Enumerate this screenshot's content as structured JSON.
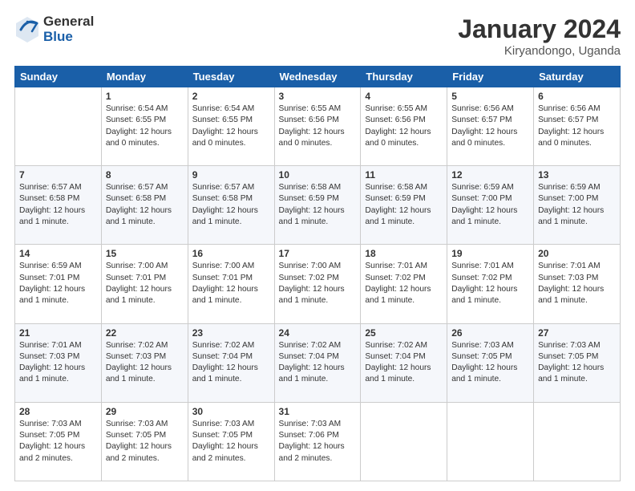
{
  "header": {
    "logo_general": "General",
    "logo_blue": "Blue",
    "month_title": "January 2024",
    "location": "Kiryandongo, Uganda"
  },
  "weekdays": [
    "Sunday",
    "Monday",
    "Tuesday",
    "Wednesday",
    "Thursday",
    "Friday",
    "Saturday"
  ],
  "weeks": [
    [
      {
        "day": "",
        "sunrise": "",
        "sunset": "",
        "daylight": ""
      },
      {
        "day": "1",
        "sunrise": "Sunrise: 6:54 AM",
        "sunset": "Sunset: 6:55 PM",
        "daylight": "Daylight: 12 hours and 0 minutes."
      },
      {
        "day": "2",
        "sunrise": "Sunrise: 6:54 AM",
        "sunset": "Sunset: 6:55 PM",
        "daylight": "Daylight: 12 hours and 0 minutes."
      },
      {
        "day": "3",
        "sunrise": "Sunrise: 6:55 AM",
        "sunset": "Sunset: 6:56 PM",
        "daylight": "Daylight: 12 hours and 0 minutes."
      },
      {
        "day": "4",
        "sunrise": "Sunrise: 6:55 AM",
        "sunset": "Sunset: 6:56 PM",
        "daylight": "Daylight: 12 hours and 0 minutes."
      },
      {
        "day": "5",
        "sunrise": "Sunrise: 6:56 AM",
        "sunset": "Sunset: 6:57 PM",
        "daylight": "Daylight: 12 hours and 0 minutes."
      },
      {
        "day": "6",
        "sunrise": "Sunrise: 6:56 AM",
        "sunset": "Sunset: 6:57 PM",
        "daylight": "Daylight: 12 hours and 0 minutes."
      }
    ],
    [
      {
        "day": "7",
        "sunrise": "Sunrise: 6:57 AM",
        "sunset": "Sunset: 6:58 PM",
        "daylight": "Daylight: 12 hours and 1 minute."
      },
      {
        "day": "8",
        "sunrise": "Sunrise: 6:57 AM",
        "sunset": "Sunset: 6:58 PM",
        "daylight": "Daylight: 12 hours and 1 minute."
      },
      {
        "day": "9",
        "sunrise": "Sunrise: 6:57 AM",
        "sunset": "Sunset: 6:58 PM",
        "daylight": "Daylight: 12 hours and 1 minute."
      },
      {
        "day": "10",
        "sunrise": "Sunrise: 6:58 AM",
        "sunset": "Sunset: 6:59 PM",
        "daylight": "Daylight: 12 hours and 1 minute."
      },
      {
        "day": "11",
        "sunrise": "Sunrise: 6:58 AM",
        "sunset": "Sunset: 6:59 PM",
        "daylight": "Daylight: 12 hours and 1 minute."
      },
      {
        "day": "12",
        "sunrise": "Sunrise: 6:59 AM",
        "sunset": "Sunset: 7:00 PM",
        "daylight": "Daylight: 12 hours and 1 minute."
      },
      {
        "day": "13",
        "sunrise": "Sunrise: 6:59 AM",
        "sunset": "Sunset: 7:00 PM",
        "daylight": "Daylight: 12 hours and 1 minute."
      }
    ],
    [
      {
        "day": "14",
        "sunrise": "Sunrise: 6:59 AM",
        "sunset": "Sunset: 7:01 PM",
        "daylight": "Daylight: 12 hours and 1 minute."
      },
      {
        "day": "15",
        "sunrise": "Sunrise: 7:00 AM",
        "sunset": "Sunset: 7:01 PM",
        "daylight": "Daylight: 12 hours and 1 minute."
      },
      {
        "day": "16",
        "sunrise": "Sunrise: 7:00 AM",
        "sunset": "Sunset: 7:01 PM",
        "daylight": "Daylight: 12 hours and 1 minute."
      },
      {
        "day": "17",
        "sunrise": "Sunrise: 7:00 AM",
        "sunset": "Sunset: 7:02 PM",
        "daylight": "Daylight: 12 hours and 1 minute."
      },
      {
        "day": "18",
        "sunrise": "Sunrise: 7:01 AM",
        "sunset": "Sunset: 7:02 PM",
        "daylight": "Daylight: 12 hours and 1 minute."
      },
      {
        "day": "19",
        "sunrise": "Sunrise: 7:01 AM",
        "sunset": "Sunset: 7:02 PM",
        "daylight": "Daylight: 12 hours and 1 minute."
      },
      {
        "day": "20",
        "sunrise": "Sunrise: 7:01 AM",
        "sunset": "Sunset: 7:03 PM",
        "daylight": "Daylight: 12 hours and 1 minute."
      }
    ],
    [
      {
        "day": "21",
        "sunrise": "Sunrise: 7:01 AM",
        "sunset": "Sunset: 7:03 PM",
        "daylight": "Daylight: 12 hours and 1 minute."
      },
      {
        "day": "22",
        "sunrise": "Sunrise: 7:02 AM",
        "sunset": "Sunset: 7:03 PM",
        "daylight": "Daylight: 12 hours and 1 minute."
      },
      {
        "day": "23",
        "sunrise": "Sunrise: 7:02 AM",
        "sunset": "Sunset: 7:04 PM",
        "daylight": "Daylight: 12 hours and 1 minute."
      },
      {
        "day": "24",
        "sunrise": "Sunrise: 7:02 AM",
        "sunset": "Sunset: 7:04 PM",
        "daylight": "Daylight: 12 hours and 1 minute."
      },
      {
        "day": "25",
        "sunrise": "Sunrise: 7:02 AM",
        "sunset": "Sunset: 7:04 PM",
        "daylight": "Daylight: 12 hours and 1 minute."
      },
      {
        "day": "26",
        "sunrise": "Sunrise: 7:03 AM",
        "sunset": "Sunset: 7:05 PM",
        "daylight": "Daylight: 12 hours and 1 minute."
      },
      {
        "day": "27",
        "sunrise": "Sunrise: 7:03 AM",
        "sunset": "Sunset: 7:05 PM",
        "daylight": "Daylight: 12 hours and 1 minute."
      }
    ],
    [
      {
        "day": "28",
        "sunrise": "Sunrise: 7:03 AM",
        "sunset": "Sunset: 7:05 PM",
        "daylight": "Daylight: 12 hours and 2 minutes."
      },
      {
        "day": "29",
        "sunrise": "Sunrise: 7:03 AM",
        "sunset": "Sunset: 7:05 PM",
        "daylight": "Daylight: 12 hours and 2 minutes."
      },
      {
        "day": "30",
        "sunrise": "Sunrise: 7:03 AM",
        "sunset": "Sunset: 7:05 PM",
        "daylight": "Daylight: 12 hours and 2 minutes."
      },
      {
        "day": "31",
        "sunrise": "Sunrise: 7:03 AM",
        "sunset": "Sunset: 7:06 PM",
        "daylight": "Daylight: 12 hours and 2 minutes."
      },
      {
        "day": "",
        "sunrise": "",
        "sunset": "",
        "daylight": ""
      },
      {
        "day": "",
        "sunrise": "",
        "sunset": "",
        "daylight": ""
      },
      {
        "day": "",
        "sunrise": "",
        "sunset": "",
        "daylight": ""
      }
    ]
  ]
}
